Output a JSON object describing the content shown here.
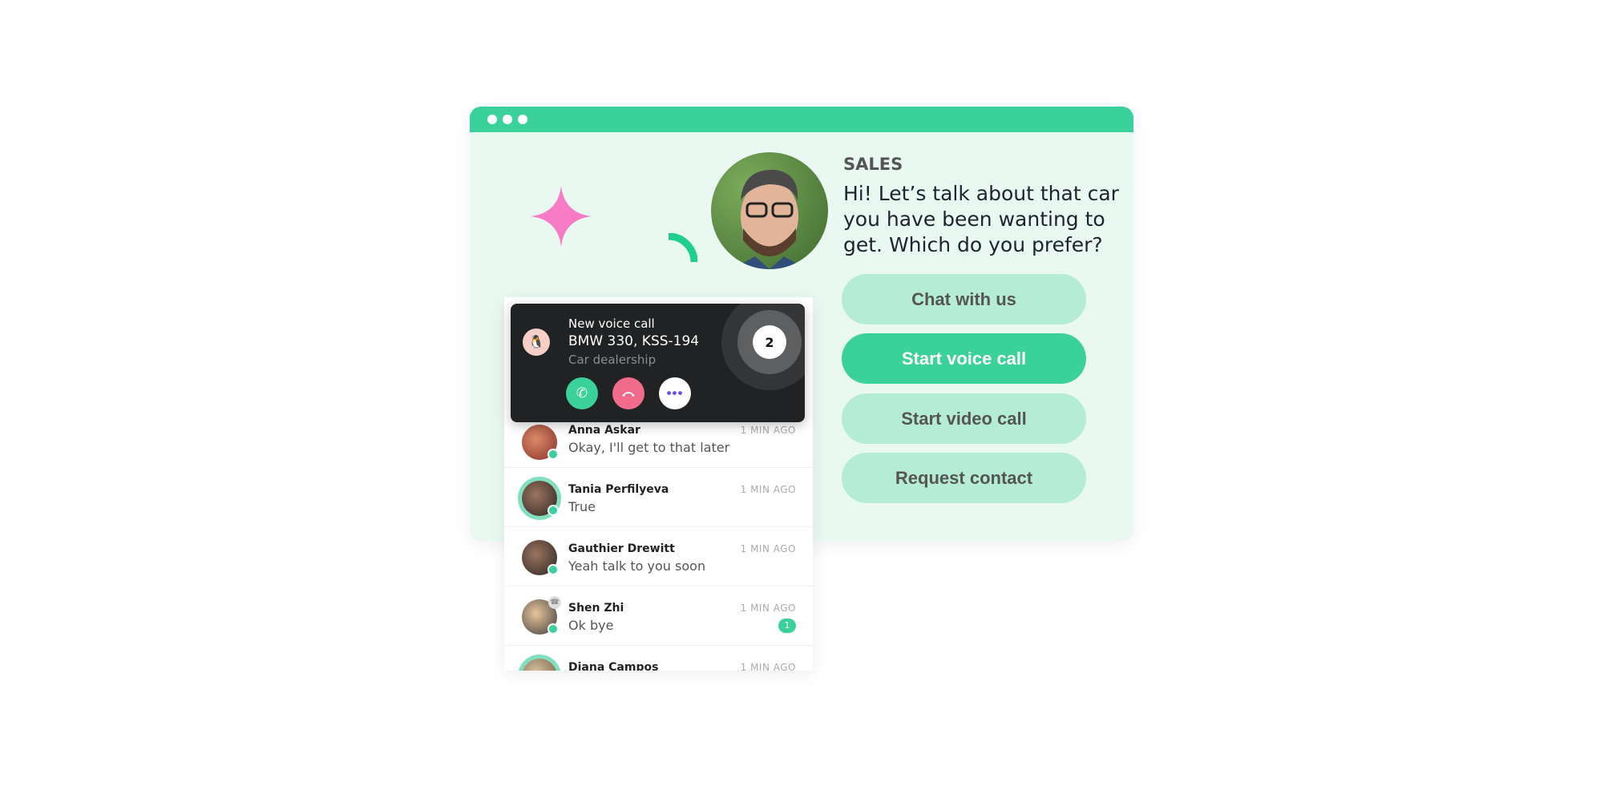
{
  "colors": {
    "accent": "#3ad19a",
    "light_accent": "#b4ecd6",
    "decline": "#f26b8a",
    "star": "#f77bc4",
    "card": "#202224"
  },
  "agent": {
    "department": "SALES",
    "message": "Hi! Let’s talk about that car you have been wanting to get. Which do you prefer?"
  },
  "options": [
    {
      "label": "Chat with us",
      "primary": false
    },
    {
      "label": "Start voice call",
      "primary": true
    },
    {
      "label": "Start video call",
      "primary": false
    },
    {
      "label": "Request contact",
      "primary": false
    }
  ],
  "call": {
    "title": "New voice call",
    "subject": "BMW 330, KSS-194",
    "source": "Car dealership",
    "queue_count": "2",
    "accept_icon": "phone-icon",
    "decline_icon": "hang-up-icon",
    "more_icon": "more-dots-icon"
  },
  "conversations": [
    {
      "name": "Anna Askar",
      "last": "Okay, I'll get to that later",
      "time": "1 MIN AGO"
    },
    {
      "name": "Tania Perfilyeva",
      "last": "True",
      "time": "1 MIN AGO"
    },
    {
      "name": "Gauthier Drewitt",
      "last": "Yeah talk to you soon",
      "time": "1 MIN AGO"
    },
    {
      "name": "Shen Zhi",
      "last": "Ok bye",
      "time": "1 MIN AGO",
      "unread": "1"
    },
    {
      "name": "Diana Campos",
      "last": "",
      "time": "1 MIN AGO"
    }
  ]
}
